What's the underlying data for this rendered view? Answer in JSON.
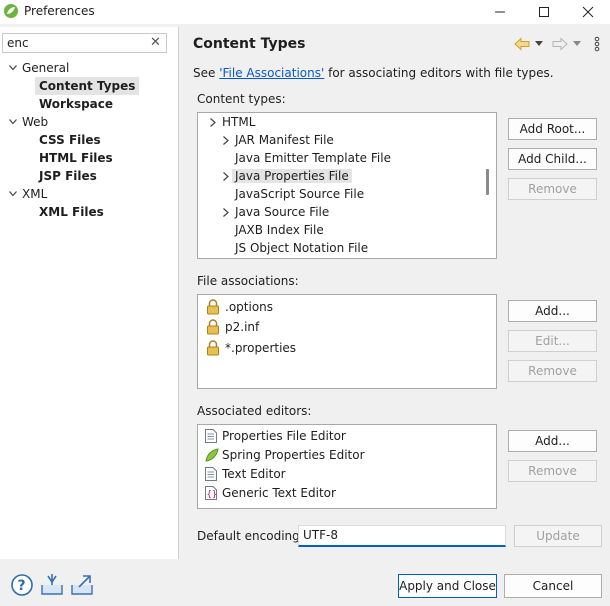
{
  "window": {
    "title": "Preferences"
  },
  "filter": {
    "value": "enc"
  },
  "tree": [
    {
      "label": "General",
      "children": [
        "Content Types",
        "Workspace"
      ]
    },
    {
      "label": "Web",
      "children": [
        "CSS Files",
        "HTML Files",
        "JSP Files"
      ]
    },
    {
      "label": "XML",
      "children": [
        "XML Files"
      ]
    }
  ],
  "page": {
    "title": "Content Types",
    "desc_prefix": "See ",
    "desc_link": "'File Associations'",
    "desc_suffix": " for associating editors with file types."
  },
  "content_types": {
    "label": "Content types:",
    "items": [
      "HTML",
      "JAR Manifest File",
      "Java Emitter Template File",
      "Java Properties File",
      "JavaScript Source File",
      "Java Source File",
      "JAXB Index File",
      "JS Object Notation File"
    ],
    "selected": "Java Properties File",
    "buttons": {
      "add_root": "Add Root...",
      "add_child": "Add Child...",
      "remove": "Remove"
    }
  },
  "file_associations": {
    "label": "File associations:",
    "items": [
      ".options",
      "p2.inf",
      "*.properties"
    ],
    "buttons": {
      "add": "Add...",
      "edit": "Edit...",
      "remove": "Remove"
    }
  },
  "associated_editors": {
    "label": "Associated editors:",
    "items": [
      "Properties File Editor",
      "Spring Properties Editor",
      "Text Editor",
      "Generic Text Editor"
    ],
    "buttons": {
      "add": "Add...",
      "remove": "Remove"
    }
  },
  "encoding": {
    "label": "Default encoding:",
    "value": "UTF-8",
    "update": "Update"
  },
  "footer": {
    "apply_close": "Apply and Close",
    "cancel": "Cancel"
  },
  "colors": {
    "accent": "#0060c0",
    "link": "#0a58c8",
    "selection": "#e4e4e4",
    "spring_green": "#6db33f",
    "lock_gold": "#e0b030"
  }
}
